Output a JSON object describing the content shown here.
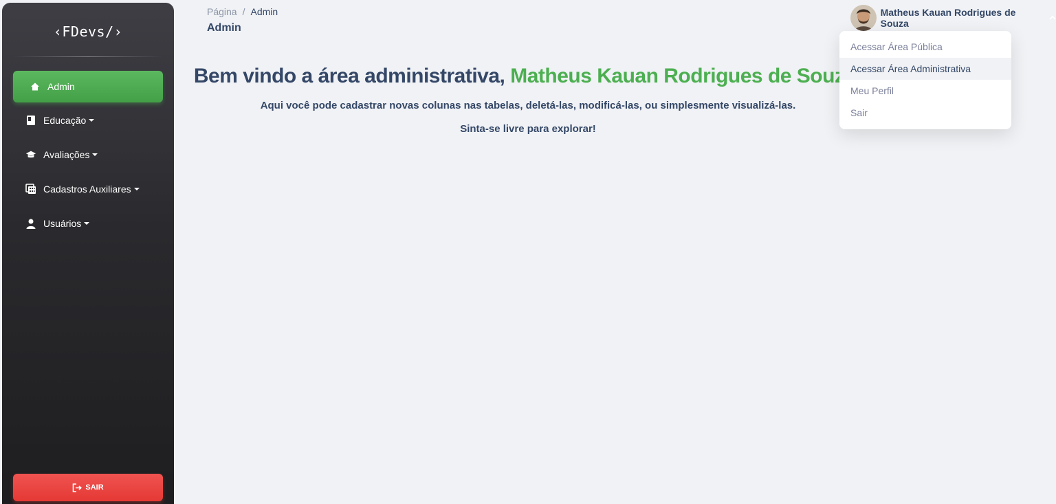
{
  "sidebar": {
    "logo": "‹FDevs/›",
    "items": [
      {
        "label": "Admin",
        "icon": "home-icon"
      },
      {
        "label": "Educação",
        "icon": "book-icon"
      },
      {
        "label": "Avaliações",
        "icon": "graduation-cap-icon"
      },
      {
        "label": "Cadastros Auxiliares",
        "icon": "calculator-icon"
      },
      {
        "label": "Usuários",
        "icon": "user-icon"
      }
    ],
    "logout_label": "SAIR"
  },
  "header": {
    "breadcrumb": {
      "root": "Página",
      "separator": "/",
      "current": "Admin"
    },
    "title": "Admin"
  },
  "main": {
    "welcome_prefix": "Bem vindo a área administrativa, ",
    "welcome_name": "Matheus Kauan Rodrigues de Souza!",
    "description": "Aqui você pode cadastrar novas colunas nas tabelas, deletá-las, modificá-las, ou simplesmente visualizá-las.",
    "explore": "Sinta-se livre para explorar!"
  },
  "user_menu": {
    "name": "Matheus Kauan Rodrigues de Souza",
    "items": [
      {
        "label": "Acessar Área Pública"
      },
      {
        "label": "Acessar Área Administrativa"
      },
      {
        "label": "Meu Perfil"
      },
      {
        "label": "Sair"
      }
    ]
  },
  "colors": {
    "accent_green": "#4caf50",
    "danger_red": "#e53935",
    "text_dark": "#344767",
    "background": "#f0f2f5"
  }
}
